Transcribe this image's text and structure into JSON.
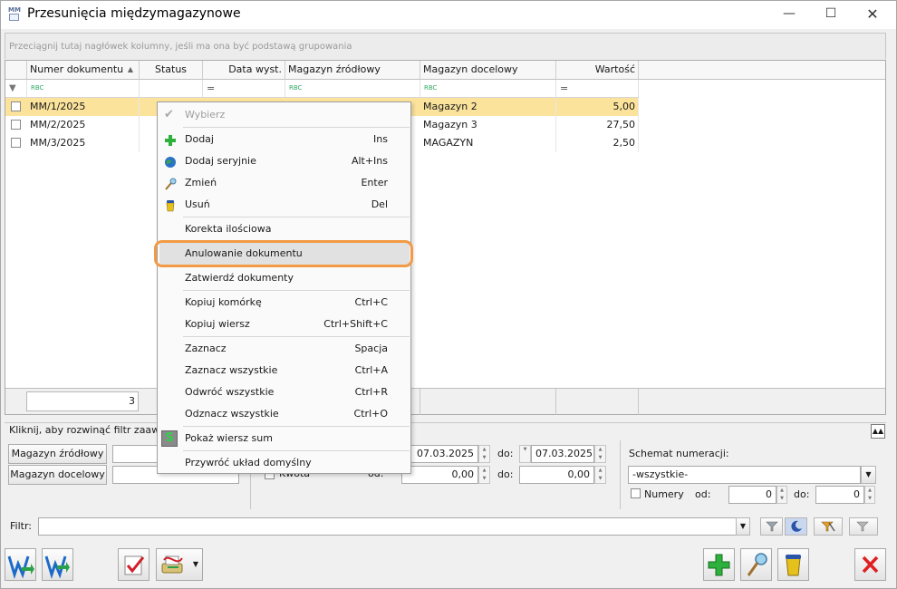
{
  "window": {
    "title": "Przesunięcia międzymagazynowe",
    "app_icon_text": "MM"
  },
  "grid": {
    "group_hint": "Przeciągnij tutaj nagłówek kolumny, jeśli ma ona być podstawą grupowania",
    "columns": [
      "Numer dokumentu",
      "Status",
      "Data wyst.",
      "Magazyn źródłowy",
      "Magazyn docelowy",
      "Wartość"
    ],
    "filter_tags": [
      "RBC",
      "=",
      "RBC",
      "RBC",
      "="
    ],
    "rows": [
      {
        "number": "MM/1/2025",
        "target": "Magazyn 2",
        "value": "5,00"
      },
      {
        "number": "MM/2/2025",
        "target": "Magazyn 3",
        "value": "27,50"
      },
      {
        "number": "MM/3/2025",
        "target": "MAGAZYN",
        "value": "2,50"
      }
    ],
    "footer_count": "3"
  },
  "context_menu": {
    "items": [
      {
        "label": "Wybierz",
        "shortcut": ""
      },
      {
        "label": "Dodaj",
        "shortcut": "Ins"
      },
      {
        "label": "Dodaj seryjnie",
        "shortcut": "Alt+Ins"
      },
      {
        "label": "Zmień",
        "shortcut": "Enter"
      },
      {
        "label": "Usuń",
        "shortcut": "Del"
      },
      {
        "label": "Korekta ilościowa",
        "shortcut": ""
      },
      {
        "label": "Anulowanie dokumentu",
        "shortcut": ""
      },
      {
        "label": "Zatwierdź dokumenty",
        "shortcut": ""
      },
      {
        "label": "Kopiuj komórkę",
        "shortcut": "Ctrl+C"
      },
      {
        "label": "Kopiuj wiersz",
        "shortcut": "Ctrl+Shift+C"
      },
      {
        "label": "Zaznacz",
        "shortcut": "Spacja"
      },
      {
        "label": "Zaznacz wszystkie",
        "shortcut": "Ctrl+A"
      },
      {
        "label": "Odwróć wszystkie",
        "shortcut": "Ctrl+R"
      },
      {
        "label": "Odznacz wszystkie",
        "shortcut": "Ctrl+O"
      },
      {
        "label": "Pokaż wiersz sum",
        "shortcut": ""
      },
      {
        "label": "Przywróć układ domyślny",
        "shortcut": ""
      }
    ],
    "highlight_color": "#f29a45"
  },
  "filters": {
    "advanced_label": "Kliknij, aby rozwinąć filtr zaawansowany",
    "source_button": "Magazyn źródłowy",
    "target_button": "Magazyn docelowy",
    "date_from": "07.03.2025",
    "date_to": "07.03.2025",
    "do_label": "do:",
    "kwota_label": "Kwota",
    "od_label": "od:",
    "amount_from": "0,00",
    "amount_to": "0,00",
    "schemat_label": "Schemat numeracji:",
    "schemat_value": "-wszystkie-",
    "numery_label": "Numery",
    "numery_od_label": "od:",
    "numery_od": "0",
    "numery_do_label": "do:",
    "numery_do": "0",
    "filtr_label": "Filtr:"
  }
}
